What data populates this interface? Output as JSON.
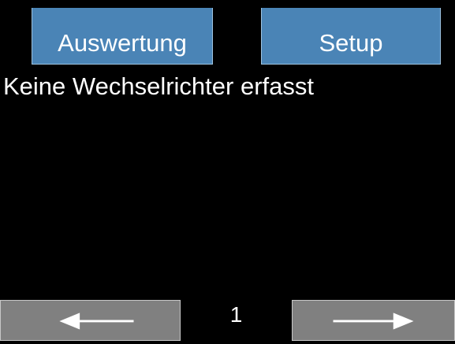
{
  "tabs": {
    "auswertung_label": "Auswertung",
    "setup_label": "Setup"
  },
  "main": {
    "message": "Keine Wechselrichter erfasst"
  },
  "pagination": {
    "page": "1",
    "prev_icon": "arrow-left-icon",
    "next_icon": "arrow-right-icon"
  },
  "colors": {
    "background": "#000000",
    "tab_button": "#4a84b6",
    "nav_button": "#808080",
    "text": "#ffffff"
  }
}
